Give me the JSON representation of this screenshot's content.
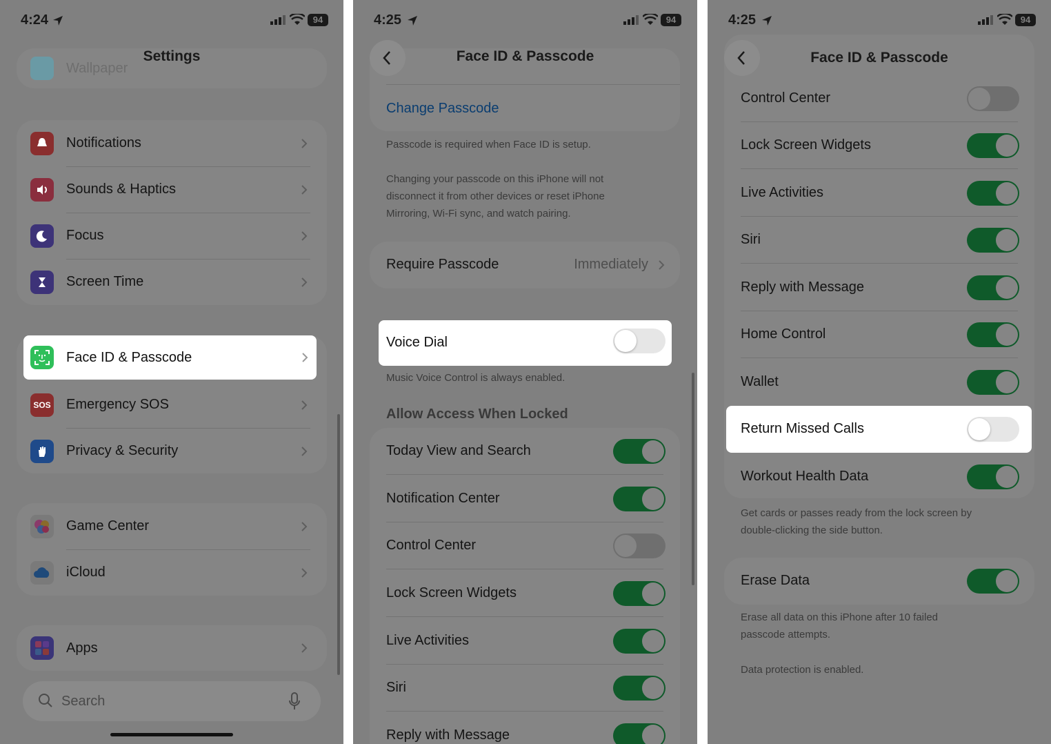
{
  "colors": {
    "dim_background": "#808080",
    "toggle_on": "#0f5a2a",
    "link": "#0a3d70",
    "highlight": "#ffffff"
  },
  "panel1": {
    "status": {
      "time": "4:24",
      "battery": "94"
    },
    "title": "Settings",
    "top_faded": "Wallpaper",
    "group1": [
      "Notifications",
      "Sounds & Haptics",
      "Focus",
      "Screen Time"
    ],
    "highlighted": "Face ID & Passcode",
    "group2": [
      "Emergency SOS",
      "Privacy & Security"
    ],
    "sos_icon_text": "SOS",
    "group3": [
      "Game Center",
      "iCloud"
    ],
    "group4": [
      "Apps"
    ],
    "search": {
      "placeholder": "Search"
    },
    "icons": [
      "bell-icon",
      "speaker-icon",
      "moon-icon",
      "hourglass-icon",
      "faceid-icon",
      "sos-icon",
      "hand-icon",
      "game-center-icon",
      "cloud-icon",
      "apps-icon",
      "search-icon",
      "mic-icon"
    ]
  },
  "panel2": {
    "status": {
      "time": "4:25",
      "battery": "94"
    },
    "title": "Face ID & Passcode",
    "change_passcode": "Change Passcode",
    "note1": "Passcode is required when Face ID is setup.",
    "note2": "Changing your passcode on this iPhone will not disconnect it from other devices or reset iPhone Mirroring, Wi-Fi sync, and watch pairing.",
    "require_passcode": {
      "label": "Require Passcode",
      "value": "Immediately"
    },
    "voice_dial": {
      "label": "Voice Dial",
      "on": false
    },
    "voice_note": "Music Voice Control is always enabled.",
    "section_header": "Allow Access When Locked",
    "toggles": [
      {
        "label": "Today View and Search",
        "on": true
      },
      {
        "label": "Notification Center",
        "on": true
      },
      {
        "label": "Control Center",
        "on": false
      },
      {
        "label": "Lock Screen Widgets",
        "on": true
      },
      {
        "label": "Live Activities",
        "on": true
      },
      {
        "label": "Siri",
        "on": true
      },
      {
        "label": "Reply with Message",
        "on": true
      }
    ]
  },
  "panel3": {
    "status": {
      "time": "4:25",
      "battery": "94"
    },
    "title": "Face ID & Passcode",
    "toggles": [
      {
        "label": "Control Center",
        "on": false
      },
      {
        "label": "Lock Screen Widgets",
        "on": true
      },
      {
        "label": "Live Activities",
        "on": true
      },
      {
        "label": "Siri",
        "on": true
      },
      {
        "label": "Reply with Message",
        "on": true
      },
      {
        "label": "Home Control",
        "on": true
      },
      {
        "label": "Wallet",
        "on": true
      }
    ],
    "highlighted": {
      "label": "Return Missed Calls",
      "on": false
    },
    "workout": {
      "label": "Workout Health Data",
      "on": true
    },
    "wallet_note": "Get cards or passes ready from the lock screen by double-clicking the side button.",
    "erase": {
      "label": "Erase Data",
      "on": true
    },
    "erase_note": "Erase all data on this iPhone after 10 failed passcode attempts.",
    "protection_note": "Data protection is enabled."
  }
}
